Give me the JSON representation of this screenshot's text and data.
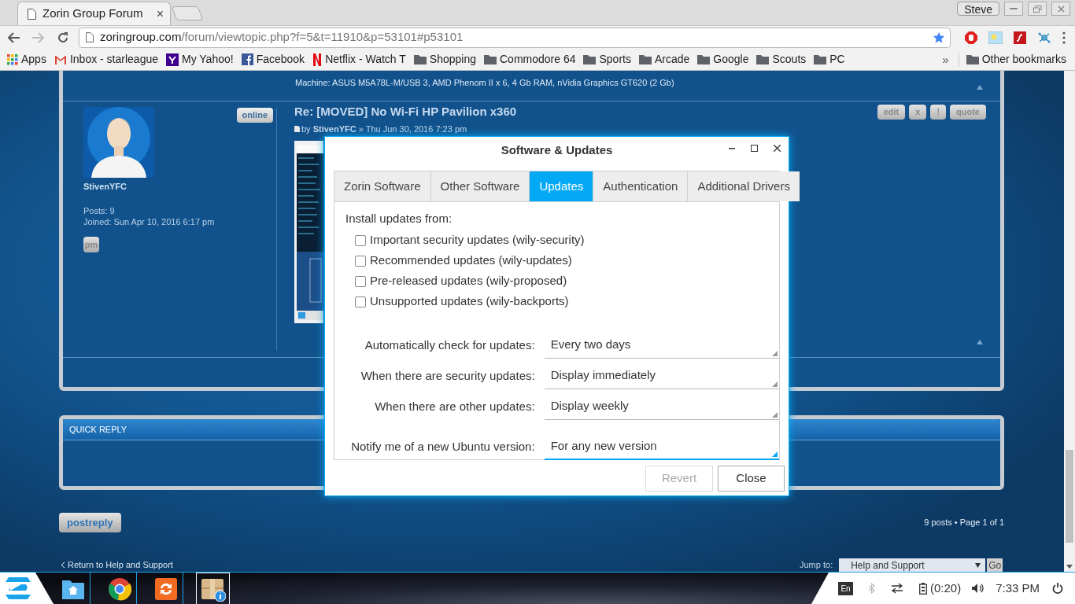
{
  "browser": {
    "tabs": [
      {
        "title": "Zorin Group Forum",
        "close": "×"
      }
    ],
    "user": "Steve",
    "url_host": "zoringroup.com",
    "url_path": "/forum/viewtopic.php?f=5&t=11910&p=53101#p53101",
    "bookmarks": [
      {
        "kind": "apps",
        "label": "Apps"
      },
      {
        "kind": "gmail",
        "label": "Inbox - starleague"
      },
      {
        "kind": "yahoo",
        "label": "My Yahoo!"
      },
      {
        "kind": "facebook",
        "label": "Facebook"
      },
      {
        "kind": "netflix",
        "label": "Netflix - Watch T"
      },
      {
        "kind": "folder",
        "label": "Shopping"
      },
      {
        "kind": "folder",
        "label": "Commodore 64"
      },
      {
        "kind": "folder",
        "label": "Sports"
      },
      {
        "kind": "folder",
        "label": "Arcade"
      },
      {
        "kind": "folder",
        "label": "Google"
      },
      {
        "kind": "folder",
        "label": "Scouts"
      },
      {
        "kind": "folder",
        "label": "PC"
      }
    ],
    "bookmarks_more": "»",
    "other_bookmarks": "Other bookmarks"
  },
  "forum": {
    "signature": "Machine: ASUS M5A78L-M/USB 3, AMD Phenom II x 6, 4 Gb RAM, nVidia Graphics GT620 (2 Gb)",
    "post": {
      "author": "StivenYFC",
      "online": "online",
      "posts": "Posts: 9",
      "joined_label": "Joined:",
      "joined": "Sun Apr 10, 2016 6:17 pm",
      "pm": "pm",
      "title": "Re: [MOVED] No Wi-Fi HP Pavilion x360",
      "byline_by": "by",
      "byline_author": "StivenYFC",
      "byline_date": "» Thu Jun 30, 2016 7:23 pm",
      "buttons": [
        "edit",
        "x",
        "!",
        "quote"
      ]
    },
    "quick_reply": "QUICK REPLY",
    "postreply": "postreply",
    "pagination": "9 posts • Page 1 of 1",
    "return_link": "Return to Help and Support",
    "jump_label": "Jump to:",
    "jump_value": "Help and Support",
    "go": "Go"
  },
  "dialog": {
    "title": "Software & Updates",
    "tabs": [
      {
        "label": "Zorin Software",
        "selected": false
      },
      {
        "label": "Other Software",
        "selected": false
      },
      {
        "label": "Updates",
        "selected": true
      },
      {
        "label": "Authentication",
        "selected": false
      },
      {
        "label": "Additional Drivers",
        "selected": false
      }
    ],
    "install_label": "Install updates from:",
    "sources": [
      {
        "label": "Important security updates (wily-security)",
        "checked": false
      },
      {
        "label": "Recommended updates (wily-updates)",
        "checked": false
      },
      {
        "label": "Pre-released updates (wily-proposed)",
        "checked": false
      },
      {
        "label": "Unsupported updates (wily-backports)",
        "checked": false
      }
    ],
    "settings": [
      {
        "label": "Automatically check for updates:",
        "value": "Every two days",
        "focused": false
      },
      {
        "label": "When there are security updates:",
        "value": "Display immediately",
        "focused": false
      },
      {
        "label": "When there are other updates:",
        "value": "Display weekly",
        "focused": false
      },
      {
        "label": "Notify me of a new Ubuntu version:",
        "value": "For any new version",
        "focused": true
      }
    ],
    "buttons": [
      {
        "label": "Revert",
        "disabled": true
      },
      {
        "label": "Close",
        "disabled": false
      }
    ]
  },
  "taskbar": {
    "apps": [
      {
        "kind": "files",
        "active": false
      },
      {
        "kind": "chrome",
        "active": false
      },
      {
        "kind": "updater",
        "active": false
      },
      {
        "kind": "package",
        "active": true
      }
    ],
    "language": "En",
    "bluetooth_on": false,
    "battery": "(0:20)",
    "clock": "7:33 PM"
  }
}
